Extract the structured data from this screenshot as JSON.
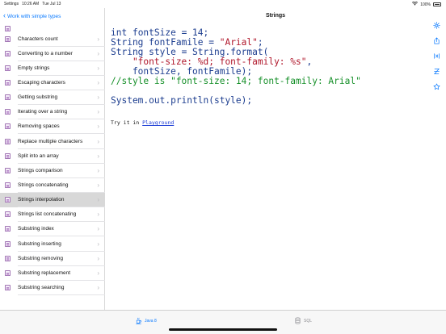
{
  "status_bar": {
    "back_app": "Settings",
    "time": "10:26 AM",
    "date": "Tue Jul 13",
    "battery": "100%"
  },
  "sidebar": {
    "back_label": "Work with simple types",
    "items": [
      {
        "label": "Characters count",
        "active": false
      },
      {
        "label": "Converting to a number",
        "active": false
      },
      {
        "label": "Empty strings",
        "active": false
      },
      {
        "label": "Escaping characters",
        "active": false
      },
      {
        "label": "Getting substring",
        "active": false
      },
      {
        "label": "Iterating over a string",
        "active": false
      },
      {
        "label": "Removing spaces",
        "active": false
      },
      {
        "label": "Replace multiple characters",
        "active": false
      },
      {
        "label": "Split into an array",
        "active": false
      },
      {
        "label": "Strings comparison",
        "active": false
      },
      {
        "label": "Strings concatenating",
        "active": false
      },
      {
        "label": "Strings interpolation",
        "active": true
      },
      {
        "label": "Strings list concatenating",
        "active": false
      },
      {
        "label": "Substring index",
        "active": false
      },
      {
        "label": "Substring inserting",
        "active": false
      },
      {
        "label": "Substring removing",
        "active": false
      },
      {
        "label": "Substring replacement",
        "active": false
      },
      {
        "label": "Substring searching",
        "active": false
      }
    ]
  },
  "main": {
    "title": "Strings",
    "code": {
      "l1_kw": "int",
      "l1_rest": " fontSize = 14;",
      "l2_kw": "String",
      "l2_rest": " fontFamile = ",
      "l2_str": "\"Arial\"",
      "l2_end": ";",
      "l3_kw": "String",
      "l3_rest": " style = String.format(",
      "l4_str": "    \"font-size: %d; font-family: %s\"",
      "l4_end": ",",
      "l5": "    fontSize, fontFamile);",
      "l6_comment": "//style is \"font-size: 14; font-family: Arial\"",
      "l8": "System.out.println(style);"
    },
    "try_text": "Try it in ",
    "try_link": "Playground"
  },
  "tabbar": {
    "java_label": "Java 8",
    "sql_label": "SQL"
  }
}
